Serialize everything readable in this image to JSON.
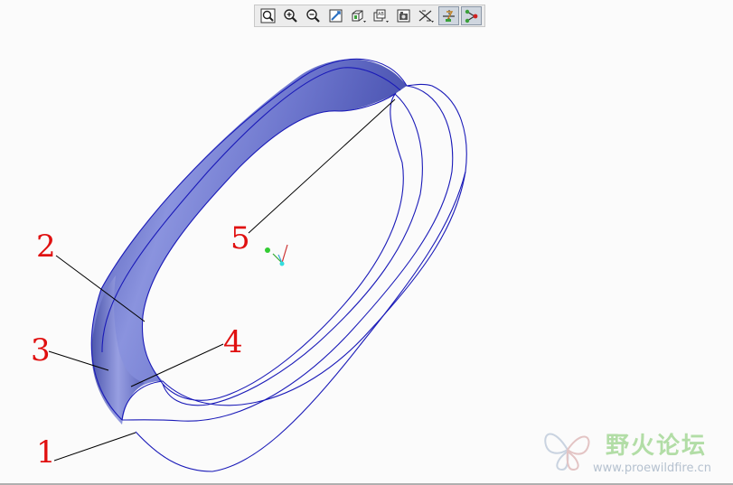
{
  "toolbar": {
    "buttons": [
      {
        "name": "refit-button",
        "icon": "refit-icon"
      },
      {
        "name": "zoom-in-button",
        "icon": "zoom-in-icon"
      },
      {
        "name": "zoom-out-button",
        "icon": "zoom-out-icon"
      },
      {
        "name": "reorient-button",
        "icon": "reorient-icon"
      },
      {
        "name": "saved-views-button",
        "icon": "saved-views-icon"
      },
      {
        "name": "layers-button",
        "icon": "layers-icon"
      },
      {
        "name": "display-style-button",
        "icon": "display-style-icon"
      },
      {
        "name": "datum-planes-button",
        "icon": "datum-planes-icon"
      },
      {
        "name": "datum-axes-button",
        "icon": "datum-axes-icon",
        "active": true
      },
      {
        "name": "datum-points-button",
        "icon": "datum-points-icon",
        "active": true
      }
    ]
  },
  "callouts": {
    "c1": "1",
    "c2": "2",
    "c3": "3",
    "c4": "4",
    "c5": "5"
  },
  "colors": {
    "model_edge": "#1a1ab8",
    "surface_shade": "#6f78cc",
    "callout": "#e01010",
    "leader": "#000000"
  },
  "watermark": {
    "title": "野火论坛",
    "url": "www.proewildfire.cn"
  }
}
